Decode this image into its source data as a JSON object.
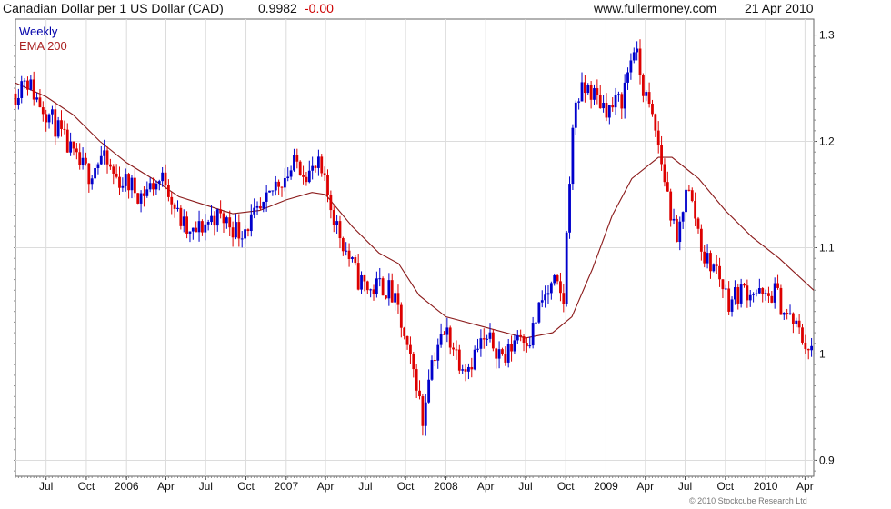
{
  "header": {
    "title": "Canadian Dollar per 1 US Dollar (CAD)",
    "last_price": "0.9982",
    "change": "-0.00",
    "site": "www.fullermoney.com",
    "date": "21 Apr 2010"
  },
  "footer": {
    "copyright": "© 2010 Stockcube Research Ltd"
  },
  "colors": {
    "up": "#0000cc",
    "down": "#dd0000",
    "ema": "#8b1a1a",
    "legend_weekly": "#0000aa",
    "legend_ema": "#aa2222",
    "grid": "#dcdcdc",
    "change": "#cc0000"
  },
  "chart_data": {
    "type": "candlestick",
    "ylim": [
      0.885,
      1.315
    ],
    "y_ticks": [
      0.9,
      1.0,
      1.1,
      1.2,
      1.3
    ],
    "y_tick_labels": [
      "0.9",
      "1",
      "1.1",
      "1.2",
      "1.3"
    ],
    "x_tick_labels": [
      "Jul",
      "Oct",
      "2006",
      "Apr",
      "Jul",
      "Oct",
      "2007",
      "Apr",
      "Jul",
      "Oct",
      "2008",
      "Apr",
      "Jul",
      "Oct",
      "2009",
      "Apr",
      "Jul",
      "Oct",
      "2010",
      "Apr"
    ],
    "x_start": "2005-04-22",
    "x_end": "2010-04-21",
    "grid": true,
    "legend_placement": "top-left",
    "legend": [
      "Weekly",
      "EMA 200"
    ],
    "series": [
      {
        "name": "Weekly",
        "kind": "ohlc-weekly",
        "close_anchors": [
          [
            "2005-04-22",
            1.245
          ],
          [
            "2005-05-13",
            1.262
          ],
          [
            "2005-06-10",
            1.24
          ],
          [
            "2005-07-08",
            1.225
          ],
          [
            "2005-08-05",
            1.205
          ],
          [
            "2005-09-09",
            1.18
          ],
          [
            "2005-10-07",
            1.17
          ],
          [
            "2005-11-04",
            1.185
          ],
          [
            "2005-12-09",
            1.165
          ],
          [
            "2006-01-06",
            1.16
          ],
          [
            "2006-02-03",
            1.15
          ],
          [
            "2006-03-03",
            1.16
          ],
          [
            "2006-03-31",
            1.165
          ],
          [
            "2006-04-28",
            1.13
          ],
          [
            "2006-05-26",
            1.11
          ],
          [
            "2006-06-23",
            1.12
          ],
          [
            "2006-07-21",
            1.13
          ],
          [
            "2006-08-18",
            1.125
          ],
          [
            "2006-09-15",
            1.115
          ],
          [
            "2006-10-13",
            1.125
          ],
          [
            "2006-11-10",
            1.135
          ],
          [
            "2006-12-08",
            1.16
          ],
          [
            "2007-01-05",
            1.17
          ],
          [
            "2007-01-26",
            1.18
          ],
          [
            "2007-02-23",
            1.17
          ],
          [
            "2007-03-16",
            1.175
          ],
          [
            "2007-04-06",
            1.15
          ],
          [
            "2007-04-27",
            1.12
          ],
          [
            "2007-05-25",
            1.09
          ],
          [
            "2007-06-15",
            1.07
          ],
          [
            "2007-07-13",
            1.06
          ],
          [
            "2007-08-03",
            1.065
          ],
          [
            "2007-08-24",
            1.06
          ],
          [
            "2007-09-14",
            1.04
          ],
          [
            "2007-10-05",
            1.0
          ],
          [
            "2007-10-26",
            0.975
          ],
          [
            "2007-11-09",
            0.935
          ],
          [
            "2007-11-23",
            0.985
          ],
          [
            "2007-12-14",
            1.01
          ],
          [
            "2008-01-04",
            1.02
          ],
          [
            "2008-02-01",
            0.995
          ],
          [
            "2008-02-22",
            0.99
          ],
          [
            "2008-03-21",
            1.01
          ],
          [
            "2008-04-18",
            1.01
          ],
          [
            "2008-05-16",
            0.995
          ],
          [
            "2008-06-13",
            1.02
          ],
          [
            "2008-07-11",
            1.015
          ],
          [
            "2008-08-08",
            1.05
          ],
          [
            "2008-09-05",
            1.065
          ],
          [
            "2008-09-26",
            1.05
          ],
          [
            "2008-10-10",
            1.17
          ],
          [
            "2008-10-24",
            1.24
          ],
          [
            "2008-11-21",
            1.25
          ],
          [
            "2008-12-12",
            1.24
          ],
          [
            "2009-01-09",
            1.23
          ],
          [
            "2009-02-06",
            1.24
          ],
          [
            "2009-03-06",
            1.29
          ],
          [
            "2009-03-27",
            1.25
          ],
          [
            "2009-04-24",
            1.21
          ],
          [
            "2009-05-22",
            1.15
          ],
          [
            "2009-06-12",
            1.1
          ],
          [
            "2009-07-03",
            1.16
          ],
          [
            "2009-07-24",
            1.13
          ],
          [
            "2009-08-14",
            1.09
          ],
          [
            "2009-09-11",
            1.08
          ],
          [
            "2009-10-09",
            1.05
          ],
          [
            "2009-11-06",
            1.06
          ],
          [
            "2009-12-04",
            1.06
          ],
          [
            "2010-01-01",
            1.05
          ],
          [
            "2010-01-22",
            1.06
          ],
          [
            "2010-02-12",
            1.04
          ],
          [
            "2010-03-05",
            1.03
          ],
          [
            "2010-04-02",
            1.01
          ],
          [
            "2010-04-21",
            0.998
          ]
        ]
      },
      {
        "name": "EMA 200",
        "kind": "line",
        "points": [
          [
            "2005-04-22",
            1.255
          ],
          [
            "2005-07-01",
            1.242
          ],
          [
            "2005-09-01",
            1.225
          ],
          [
            "2005-11-01",
            1.2
          ],
          [
            "2006-01-01",
            1.18
          ],
          [
            "2006-03-01",
            1.165
          ],
          [
            "2006-05-01",
            1.148
          ],
          [
            "2006-07-01",
            1.14
          ],
          [
            "2006-09-01",
            1.132
          ],
          [
            "2006-11-01",
            1.135
          ],
          [
            "2007-01-01",
            1.145
          ],
          [
            "2007-03-01",
            1.152
          ],
          [
            "2007-04-01",
            1.15
          ],
          [
            "2007-06-01",
            1.12
          ],
          [
            "2007-08-01",
            1.095
          ],
          [
            "2007-09-15",
            1.085
          ],
          [
            "2007-11-01",
            1.055
          ],
          [
            "2008-01-01",
            1.035
          ],
          [
            "2008-04-01",
            1.025
          ],
          [
            "2008-07-01",
            1.015
          ],
          [
            "2008-09-01",
            1.02
          ],
          [
            "2008-10-15",
            1.035
          ],
          [
            "2008-12-01",
            1.08
          ],
          [
            "2009-01-15",
            1.13
          ],
          [
            "2009-03-01",
            1.165
          ],
          [
            "2009-05-01",
            1.185
          ],
          [
            "2009-06-01",
            1.185
          ],
          [
            "2009-08-01",
            1.165
          ],
          [
            "2009-10-01",
            1.135
          ],
          [
            "2009-12-01",
            1.11
          ],
          [
            "2010-02-01",
            1.09
          ],
          [
            "2010-04-21",
            1.06
          ]
        ]
      }
    ]
  }
}
